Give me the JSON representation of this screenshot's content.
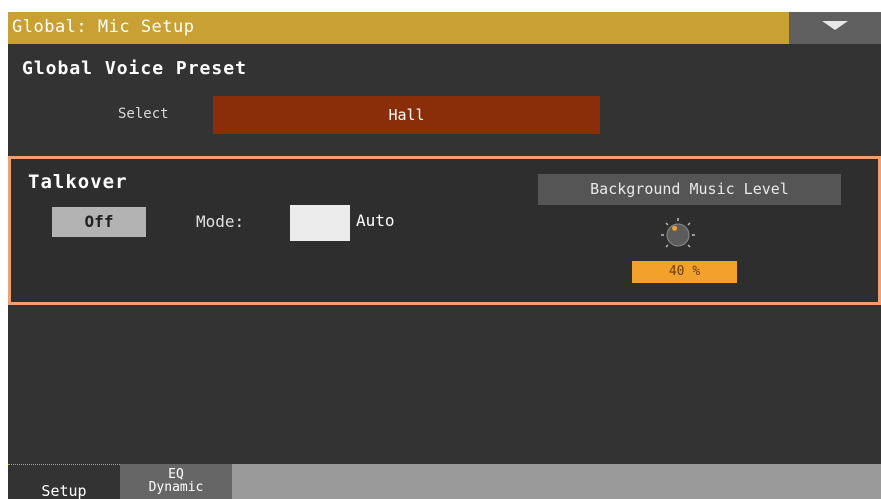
{
  "window": {
    "title": "Global: Mic Setup"
  },
  "global_voice_preset": {
    "header": "Global Voice Preset",
    "select_label": "Select",
    "select_value": "Hall"
  },
  "talkover": {
    "title": "Talkover",
    "toggle_label": "Off",
    "mode_label": "Mode:",
    "mode_value": "Auto",
    "bgm_label": "Background Music Level",
    "bgm_value": "40 %",
    "bgm_level_fraction": 0.4
  },
  "tabs": [
    {
      "label": "Setup",
      "active": true
    },
    {
      "label": "EQ\nDynamic",
      "active": false
    }
  ],
  "icons": {
    "menu": "dropdown-arrow-icon",
    "knob": "rotary-knob-icon"
  },
  "colors": {
    "title_bar": "#c9a033",
    "select_field": "#8a2e0a",
    "panel_border": "#f0a070",
    "value_badge": "#f2a12a"
  }
}
